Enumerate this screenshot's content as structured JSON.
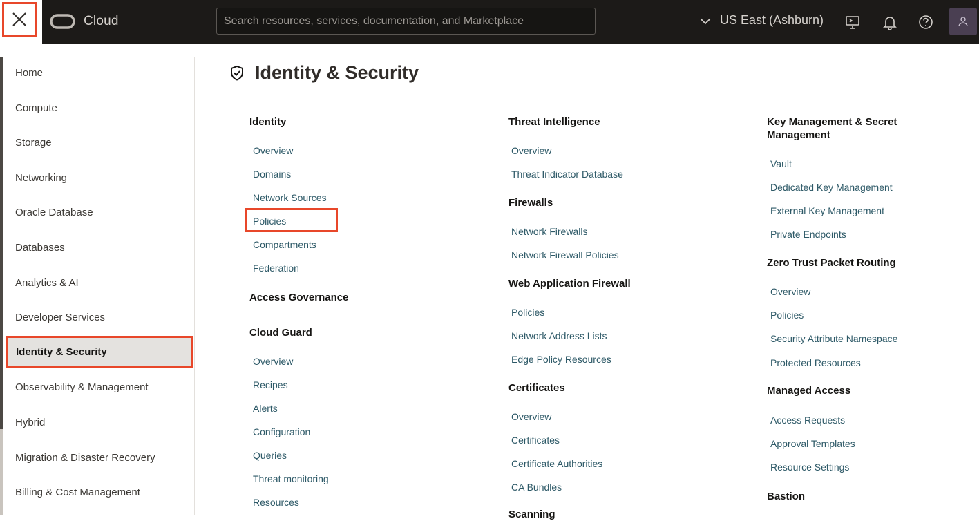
{
  "header": {
    "brand": "Cloud",
    "search_placeholder": "Search resources, services, documentation, and Marketplace",
    "region": "US East (Ashburn)"
  },
  "sidebar": {
    "items": [
      {
        "label": "Home"
      },
      {
        "label": "Compute"
      },
      {
        "label": "Storage"
      },
      {
        "label": "Networking"
      },
      {
        "label": "Oracle Database"
      },
      {
        "label": "Databases"
      },
      {
        "label": "Analytics & AI"
      },
      {
        "label": "Developer Services"
      },
      {
        "label": "Identity & Security"
      },
      {
        "label": "Observability & Management"
      },
      {
        "label": "Hybrid"
      },
      {
        "label": "Migration & Disaster Recovery"
      },
      {
        "label": "Billing & Cost Management"
      }
    ]
  },
  "main": {
    "title": "Identity & Security",
    "col1": {
      "identity": {
        "heading": "Identity",
        "links": [
          "Overview",
          "Domains",
          "Network Sources",
          "Policies",
          "Compartments",
          "Federation"
        ]
      },
      "access_governance": {
        "heading": "Access Governance"
      },
      "cloud_guard": {
        "heading": "Cloud Guard",
        "links": [
          "Overview",
          "Recipes",
          "Alerts",
          "Configuration",
          "Queries",
          "Threat monitoring",
          "Resources"
        ]
      }
    },
    "col2": {
      "threat_intel": {
        "heading": "Threat Intelligence",
        "links": [
          "Overview",
          "Threat Indicator Database"
        ]
      },
      "firewalls": {
        "heading": "Firewalls",
        "links": [
          "Network Firewalls",
          "Network Firewall Policies"
        ]
      },
      "waf": {
        "heading": "Web Application Firewall",
        "links": [
          "Policies",
          "Network Address Lists",
          "Edge Policy Resources"
        ]
      },
      "certificates": {
        "heading": "Certificates",
        "links": [
          "Overview",
          "Certificates",
          "Certificate Authorities",
          "CA Bundles"
        ]
      },
      "scanning": {
        "heading": "Scanning"
      }
    },
    "col3": {
      "kms": {
        "heading": "Key Management & Secret Management",
        "links": [
          "Vault",
          "Dedicated Key Management",
          "External Key Management",
          "Private Endpoints"
        ]
      },
      "ztpr": {
        "heading": "Zero Trust Packet Routing",
        "links": [
          "Overview",
          "Policies",
          "Security Attribute Namespace",
          "Protected Resources"
        ]
      },
      "managed_access": {
        "heading": "Managed Access",
        "links": [
          "Access Requests",
          "Approval Templates",
          "Resource Settings"
        ]
      },
      "bastion": {
        "heading": "Bastion"
      }
    }
  },
  "colors": {
    "accent_highlight": "#e8472a",
    "header_bg": "#1c1a18",
    "link": "#2d5967"
  }
}
